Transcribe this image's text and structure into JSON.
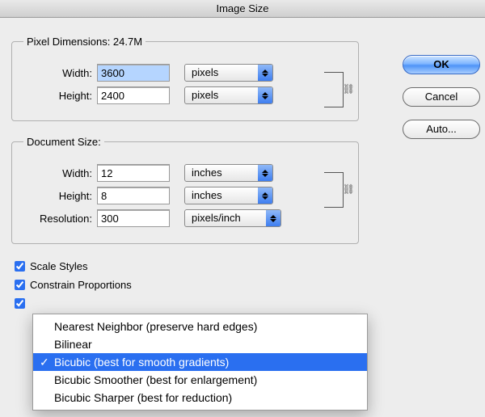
{
  "title": "Image Size",
  "buttons": {
    "ok": "OK",
    "cancel": "Cancel",
    "auto": "Auto..."
  },
  "pixelDimensions": {
    "legend": "Pixel Dimensions:  24.7M",
    "widthLabel": "Width:",
    "widthValue": "3600",
    "widthUnit": "pixels",
    "heightLabel": "Height:",
    "heightValue": "2400",
    "heightUnit": "pixels"
  },
  "documentSize": {
    "legend": "Document Size:",
    "widthLabel": "Width:",
    "widthValue": "12",
    "widthUnit": "inches",
    "heightLabel": "Height:",
    "heightValue": "8",
    "heightUnit": "inches",
    "resLabel": "Resolution:",
    "resValue": "300",
    "resUnit": "pixels/inch"
  },
  "checks": {
    "scaleStyles": "Scale Styles",
    "constrain": "Constrain Proportions"
  },
  "menu": {
    "items": [
      "Nearest Neighbor (preserve hard edges)",
      "Bilinear",
      "Bicubic (best for smooth gradients)",
      "Bicubic Smoother (best for enlargement)",
      "Bicubic Sharper (best for reduction)"
    ]
  }
}
